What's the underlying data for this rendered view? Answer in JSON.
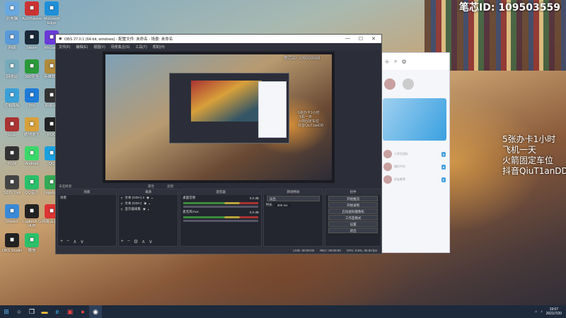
{
  "watermark": "笔芯ID: 109503559",
  "overlay_lines": [
    "5张办卡1小时",
    "飞机一天",
    "火箭固定车位",
    "抖音QiuT1anDD"
  ],
  "desktop_icons": [
    {
      "label": "此电脑",
      "icon": "computer-icon",
      "color": "#6aa9e0"
    },
    {
      "label": "AcDPulsive",
      "icon": "app-icon",
      "color": "#c33"
    },
    {
      "label": "Microsoft Edge",
      "icon": "edge-icon",
      "color": "#1e8fd8"
    },
    {
      "label": "网络",
      "icon": "network-icon",
      "color": "#5a9ad8"
    },
    {
      "label": "Steam",
      "icon": "steam-icon",
      "color": "#1b2838"
    },
    {
      "label": "WeGame",
      "icon": "wegame-icon",
      "color": "#6a3ad8"
    },
    {
      "label": "回收站",
      "icon": "recycle-bin-icon",
      "color": "#7ab"
    },
    {
      "label": "360安全",
      "icon": "shield-icon",
      "color": "#2a9a3a"
    },
    {
      "label": "英雄联盟",
      "icon": "lol-icon",
      "color": "#b08a3a"
    },
    {
      "label": "控制面板",
      "icon": "control-panel-icon",
      "color": "#3aa0d8"
    },
    {
      "label": "360",
      "icon": "guard-icon",
      "color": "#1e7bd8"
    },
    {
      "label": "网易UU",
      "icon": "uu-icon",
      "color": "#333"
    },
    {
      "label": "GGL",
      "icon": "game-icon",
      "color": "#a33"
    },
    {
      "label": "绝地求生",
      "icon": "pubg-icon",
      "color": "#d8a03a"
    },
    {
      "label": "ROG",
      "icon": "rog-icon",
      "color": "#222"
    },
    {
      "label": "PGM",
      "icon": "app-icon",
      "color": "#333"
    },
    {
      "label": "Android",
      "icon": "android-icon",
      "color": "#3ad86a"
    },
    {
      "label": "QQ",
      "icon": "qq-icon",
      "color": "#1aa0e0"
    },
    {
      "label": "SDIS Tool",
      "icon": "tool-icon",
      "color": "#444"
    },
    {
      "label": "QQ音乐",
      "icon": "music-icon",
      "color": "#2ac06a"
    },
    {
      "label": "Gigabyte",
      "icon": "app-icon",
      "color": "#3a5"
    },
    {
      "label": "ShareX",
      "icon": "app-icon",
      "color": "#3a8ad8"
    },
    {
      "label": "Logitech G HUB",
      "icon": "logitech-icon",
      "color": "#222"
    },
    {
      "label": "网易云音乐",
      "icon": "netease-music-icon",
      "color": "#d33"
    },
    {
      "label": "OBS Studio",
      "icon": "obs-icon",
      "color": "#222"
    },
    {
      "label": "微信",
      "icon": "wechat-icon",
      "color": "#2ac06a"
    }
  ],
  "obs": {
    "title": "OBS 27.0.1 (64-bit, windows) - 配置文件: 未命名 - 场景: 未命名",
    "menu": [
      "文件(F)",
      "编辑(E)",
      "视图(V)",
      "场景集合(S)",
      "工具(T)",
      "帮助(H)"
    ],
    "preview_id": "笔芯ID: 109503559",
    "preview_overlay": [
      "5张办卡1小时",
      "飞机一天",
      "火箭固定车位",
      "抖音QiuT1anDD"
    ],
    "source_bar": {
      "label": "未选择源",
      "props": "属性",
      "filters": "滤镜"
    },
    "docks": {
      "scenes": {
        "title": "场景",
        "items": [
          "场景"
        ]
      },
      "sources": {
        "title": "来源",
        "items": [
          "文本 (GDI+) 2",
          "文本 (GDI+)",
          "显示器采集"
        ]
      },
      "mixer": {
        "title": "混音器",
        "channels": [
          {
            "name": "桌面音频",
            "db": "0.0 dB"
          },
          {
            "name": "麦克风/Aux",
            "db": "0.0 dB"
          }
        ]
      },
      "transitions": {
        "title": "转场特效",
        "type": "淡出",
        "duration_label": "时长",
        "duration": "300 ms"
      },
      "controls": {
        "title": "控件",
        "buttons": [
          "开始推流",
          "开始录制",
          "启动虚拟摄像机",
          "工作室模式",
          "设置",
          "退出"
        ]
      }
    },
    "status": {
      "live": "LIVE: 00:00:00",
      "rec": "REC: 00:00:00",
      "cpu": "CPU: 0.5%, 30.00 fps"
    }
  },
  "chat": {
    "rows": [
      "小学生团队",
      "相约平台",
      "好友推荐"
    ]
  },
  "taskbar": {
    "apps": [
      "start",
      "search",
      "task-view",
      "file-explorer",
      "edge",
      "app",
      "qq",
      "obs"
    ],
    "time": "19:07",
    "date": "2021/7/20"
  }
}
